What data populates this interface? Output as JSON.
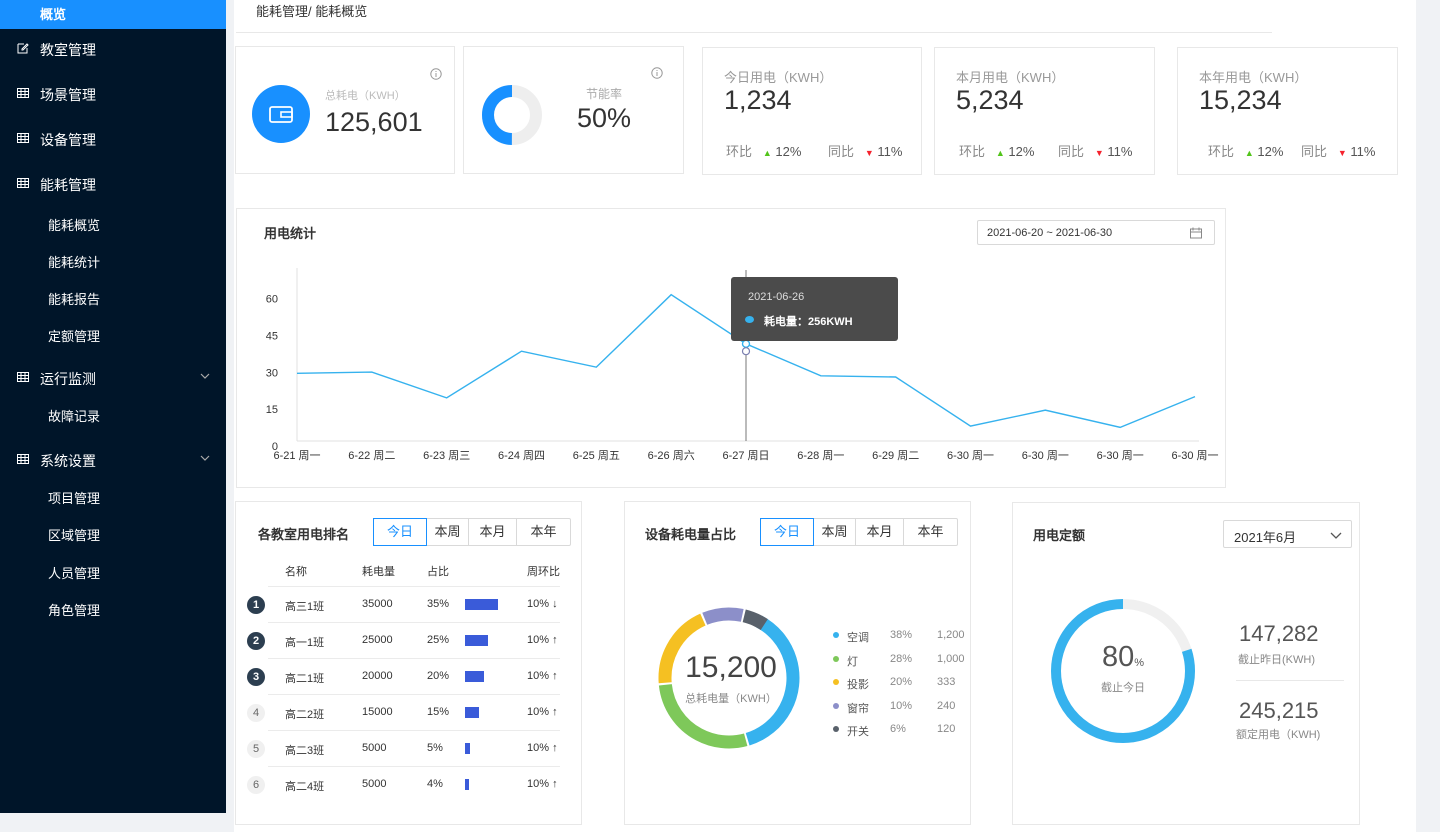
{
  "sidebar": {
    "active": "概览",
    "items": [
      {
        "label": "教室管理",
        "icon": "edit-icon"
      },
      {
        "label": "场景管理",
        "icon": "grid-icon"
      },
      {
        "label": "设备管理",
        "icon": "grid-icon"
      },
      {
        "label": "能耗管理",
        "icon": "grid-icon"
      },
      {
        "label": "运行监测",
        "icon": "grid-icon"
      },
      {
        "label": "系统设置",
        "icon": "grid-icon"
      }
    ],
    "energy_sub": [
      "能耗概览",
      "能耗统计",
      "能耗报告",
      "定额管理"
    ],
    "monitor_sub": [
      "故障记录"
    ],
    "system_sub": [
      "项目管理",
      "区域管理",
      "人员管理",
      "角色管理"
    ]
  },
  "breadcrumb": "能耗管理/ 能耗概览",
  "stats": {
    "total": {
      "title": "总耗电（KWH）",
      "value": "125,601"
    },
    "saving": {
      "title": "节能率",
      "value": "50%",
      "ratio": 0.5
    },
    "cards": [
      {
        "title": "今日用电（KWH）",
        "value": "1,234",
        "mom_label": "环比",
        "mom": "12%",
        "yoy_label": "同比",
        "yoy": "11%"
      },
      {
        "title": "本月用电（KWH）",
        "value": "5,234",
        "mom_label": "环比",
        "mom": "12%",
        "yoy_label": "同比",
        "yoy": "11%"
      },
      {
        "title": "本年用电（KWH）",
        "value": "15,234",
        "mom_label": "环比",
        "mom": "12%",
        "yoy_label": "同比",
        "yoy": "11%"
      }
    ]
  },
  "usage": {
    "title": "用电统计",
    "date_range": "2021-06-20 ~ 2021-06-30",
    "tooltip": {
      "date": "2021-06-26",
      "label": "耗电量：256KWH"
    }
  },
  "chart_data": {
    "type": "line",
    "x": [
      "6-21 周一",
      "6-22 周二",
      "6-23 周三",
      "6-24 周四",
      "6-25 周五",
      "6-26 周六",
      "6-27 周日",
      "6-28 周一",
      "6-29 周二",
      "6-30 周一",
      "6-30 周一",
      "6-30 周一",
      "6-30 周一"
    ],
    "series": [
      {
        "values": [
          30,
          30.5,
          20,
          39,
          32.5,
          62,
          42,
          29,
          28.5,
          8.5,
          15,
          8,
          20.5
        ],
        "color": "#36b2ee"
      }
    ],
    "yticks": [
      0,
      15,
      30,
      45,
      60
    ],
    "ylim": [
      0,
      70
    ],
    "grid": false,
    "hover_index": 6,
    "hover_y": 39
  },
  "ranking": {
    "title": "各教室用电排名",
    "tabs": [
      "今日",
      "本周",
      "本月",
      "本年"
    ],
    "headers": [
      "名称",
      "耗电量",
      "占比",
      "周环比"
    ],
    "rows": [
      {
        "rank": "1",
        "name": "高三1班",
        "value": "35000",
        "pct": "35%",
        "share": 0.35,
        "change": "10% ↓"
      },
      {
        "rank": "2",
        "name": "高一1班",
        "value": "25000",
        "pct": "25%",
        "share": 0.25,
        "change": "10% ↑"
      },
      {
        "rank": "3",
        "name": "高二1班",
        "value": "20000",
        "pct": "20%",
        "share": 0.2,
        "change": "10% ↑"
      },
      {
        "rank": "4",
        "name": "高二2班",
        "value": "15000",
        "pct": "15%",
        "share": 0.15,
        "change": "10% ↑"
      },
      {
        "rank": "5",
        "name": "高二3班",
        "value": "5000",
        "pct": "5%",
        "share": 0.05,
        "change": "10% ↑"
      },
      {
        "rank": "6",
        "name": "高二4班",
        "value": "5000",
        "pct": "4%",
        "share": 0.04,
        "change": "10% ↑"
      }
    ]
  },
  "device": {
    "title": "设备耗电量占比",
    "tabs": [
      "今日",
      "本周",
      "本月",
      "本年"
    ],
    "total": "15,200",
    "total_label": "总耗电量（KWH）",
    "items": [
      {
        "name": "空调",
        "pct": "38%",
        "value": "1,200",
        "share": 0.38,
        "color": "#36b2ee"
      },
      {
        "name": "灯",
        "pct": "28%",
        "value": "1,000",
        "share": 0.28,
        "color": "#7ec85a"
      },
      {
        "name": "投影",
        "pct": "20%",
        "value": "333",
        "share": 0.2,
        "color": "#f5c022"
      },
      {
        "name": "窗帘",
        "pct": "10%",
        "value": "240",
        "share": 0.1,
        "color": "#8c8fc9"
      },
      {
        "name": "开关",
        "pct": "6%",
        "value": "120",
        "share": 0.06,
        "color": "#59616b"
      }
    ]
  },
  "quota": {
    "title": "用电定额",
    "month": "2021年6月",
    "percent": "80",
    "percent_unit": "%",
    "ratio": 0.8,
    "center_label": "截止今日",
    "yesterday_value": "147,282",
    "yesterday_label": "截止昨日(KWH)",
    "quota_value": "245,215",
    "quota_label": "额定用电（KWH)"
  },
  "colors": {
    "accent": "#1890ff",
    "sidebar": "#001529",
    "line": "#36b2ee",
    "bar": "#3a5bd9",
    "ring": "#36b2ee"
  }
}
